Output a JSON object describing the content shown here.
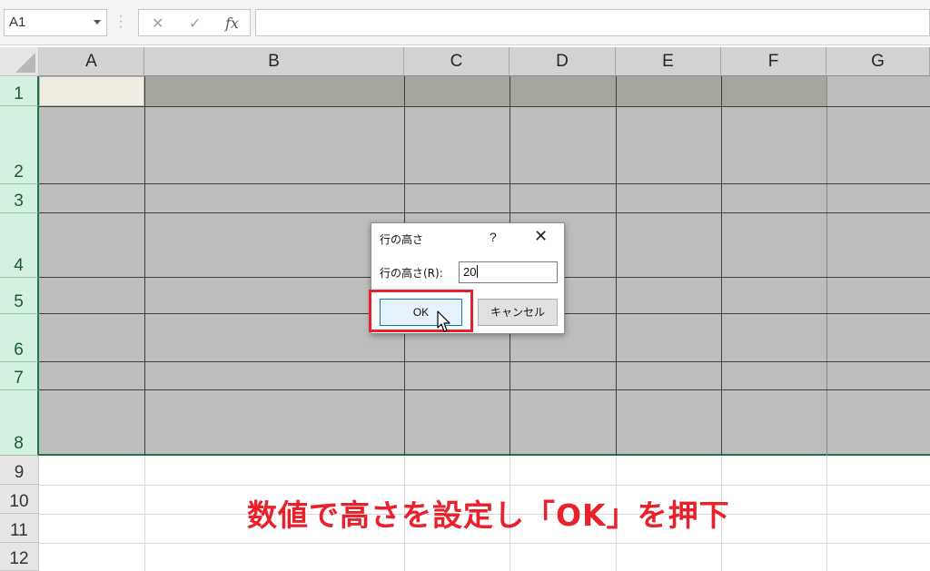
{
  "formula_bar": {
    "name_box": "A1",
    "cancel_glyph": "✕",
    "enter_glyph": "✓",
    "fx_label": "fx",
    "formula": ""
  },
  "columns": [
    "A",
    "B",
    "C",
    "D",
    "E",
    "F",
    "G"
  ],
  "rows": [
    "1",
    "2",
    "3",
    "4",
    "5",
    "6",
    "7",
    "8",
    "9",
    "10",
    "11",
    "12"
  ],
  "dialog": {
    "title": "行の高さ",
    "help": "?",
    "close": "✕",
    "field_label": "行の高さ(R):",
    "field_value": "20",
    "ok_label": "OK",
    "cancel_label": "キャンセル"
  },
  "caption": "数値で高さを設定し「OK」を押下",
  "colors": {
    "selection_fill": "#bdbdbd",
    "header_selected": "#d3f0e0",
    "excel_green": "#217346",
    "highlight_red": "#e8212b"
  }
}
